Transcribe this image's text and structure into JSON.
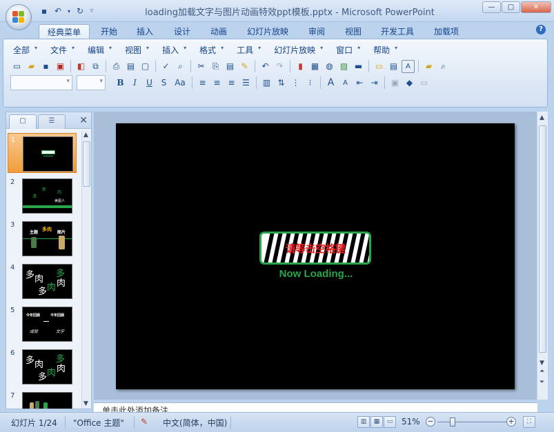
{
  "window": {
    "title": "loading加载文字与图片动画特效ppt模板.pptx - Microsoft PowerPoint"
  },
  "ribbon_tabs": [
    {
      "label": "经典菜单",
      "active": true
    },
    {
      "label": "开始"
    },
    {
      "label": "插入"
    },
    {
      "label": "设计"
    },
    {
      "label": "动画"
    },
    {
      "label": "幻灯片放映"
    },
    {
      "label": "审阅"
    },
    {
      "label": "视图"
    },
    {
      "label": "开发工具"
    },
    {
      "label": "加载项"
    }
  ],
  "classic_menu": [
    "全部",
    "文件",
    "编辑",
    "视图",
    "插入",
    "格式",
    "工具",
    "幻灯片放映",
    "窗口",
    "帮助"
  ],
  "format_toolbar": {
    "bold": "B",
    "italic": "I",
    "underline": "U",
    "strike": "S",
    "font_size_case": "Aa",
    "font_grow": "A"
  },
  "slide_panel": {
    "slides": [
      {
        "num": "1"
      },
      {
        "num": "2"
      },
      {
        "num": "3"
      },
      {
        "num": "4"
      },
      {
        "num": "5"
      },
      {
        "num": "6"
      },
      {
        "num": "7"
      }
    ],
    "thumb_texts": {
      "s2": [
        "清",
        "新",
        "肉",
        "美图人"
      ],
      "s3": [
        "主题",
        "多肉",
        "图片"
      ],
      "s4": [
        "多",
        "肉",
        "多",
        "肉",
        "多"
      ],
      "s5": [
        "今年回顾",
        "今年回顾",
        "成就",
        "文字"
      ],
      "s6": [
        "多",
        "肉",
        "多",
        "肉",
        "多"
      ]
    }
  },
  "slide": {
    "loader_text": "请等击空格键",
    "loading_label": "Now Loading..."
  },
  "notes": {
    "text": "单击此处添加备注"
  },
  "status": {
    "slide_counter": "幻灯片 1/24",
    "theme": "\"Office 主题\"",
    "language": "中文(简体，中国)",
    "zoom": "51%"
  },
  "colors": {
    "accent_green": "#29a54b",
    "loader_text_red": "#e41b1b",
    "selected_orange": "#f29c3b"
  }
}
